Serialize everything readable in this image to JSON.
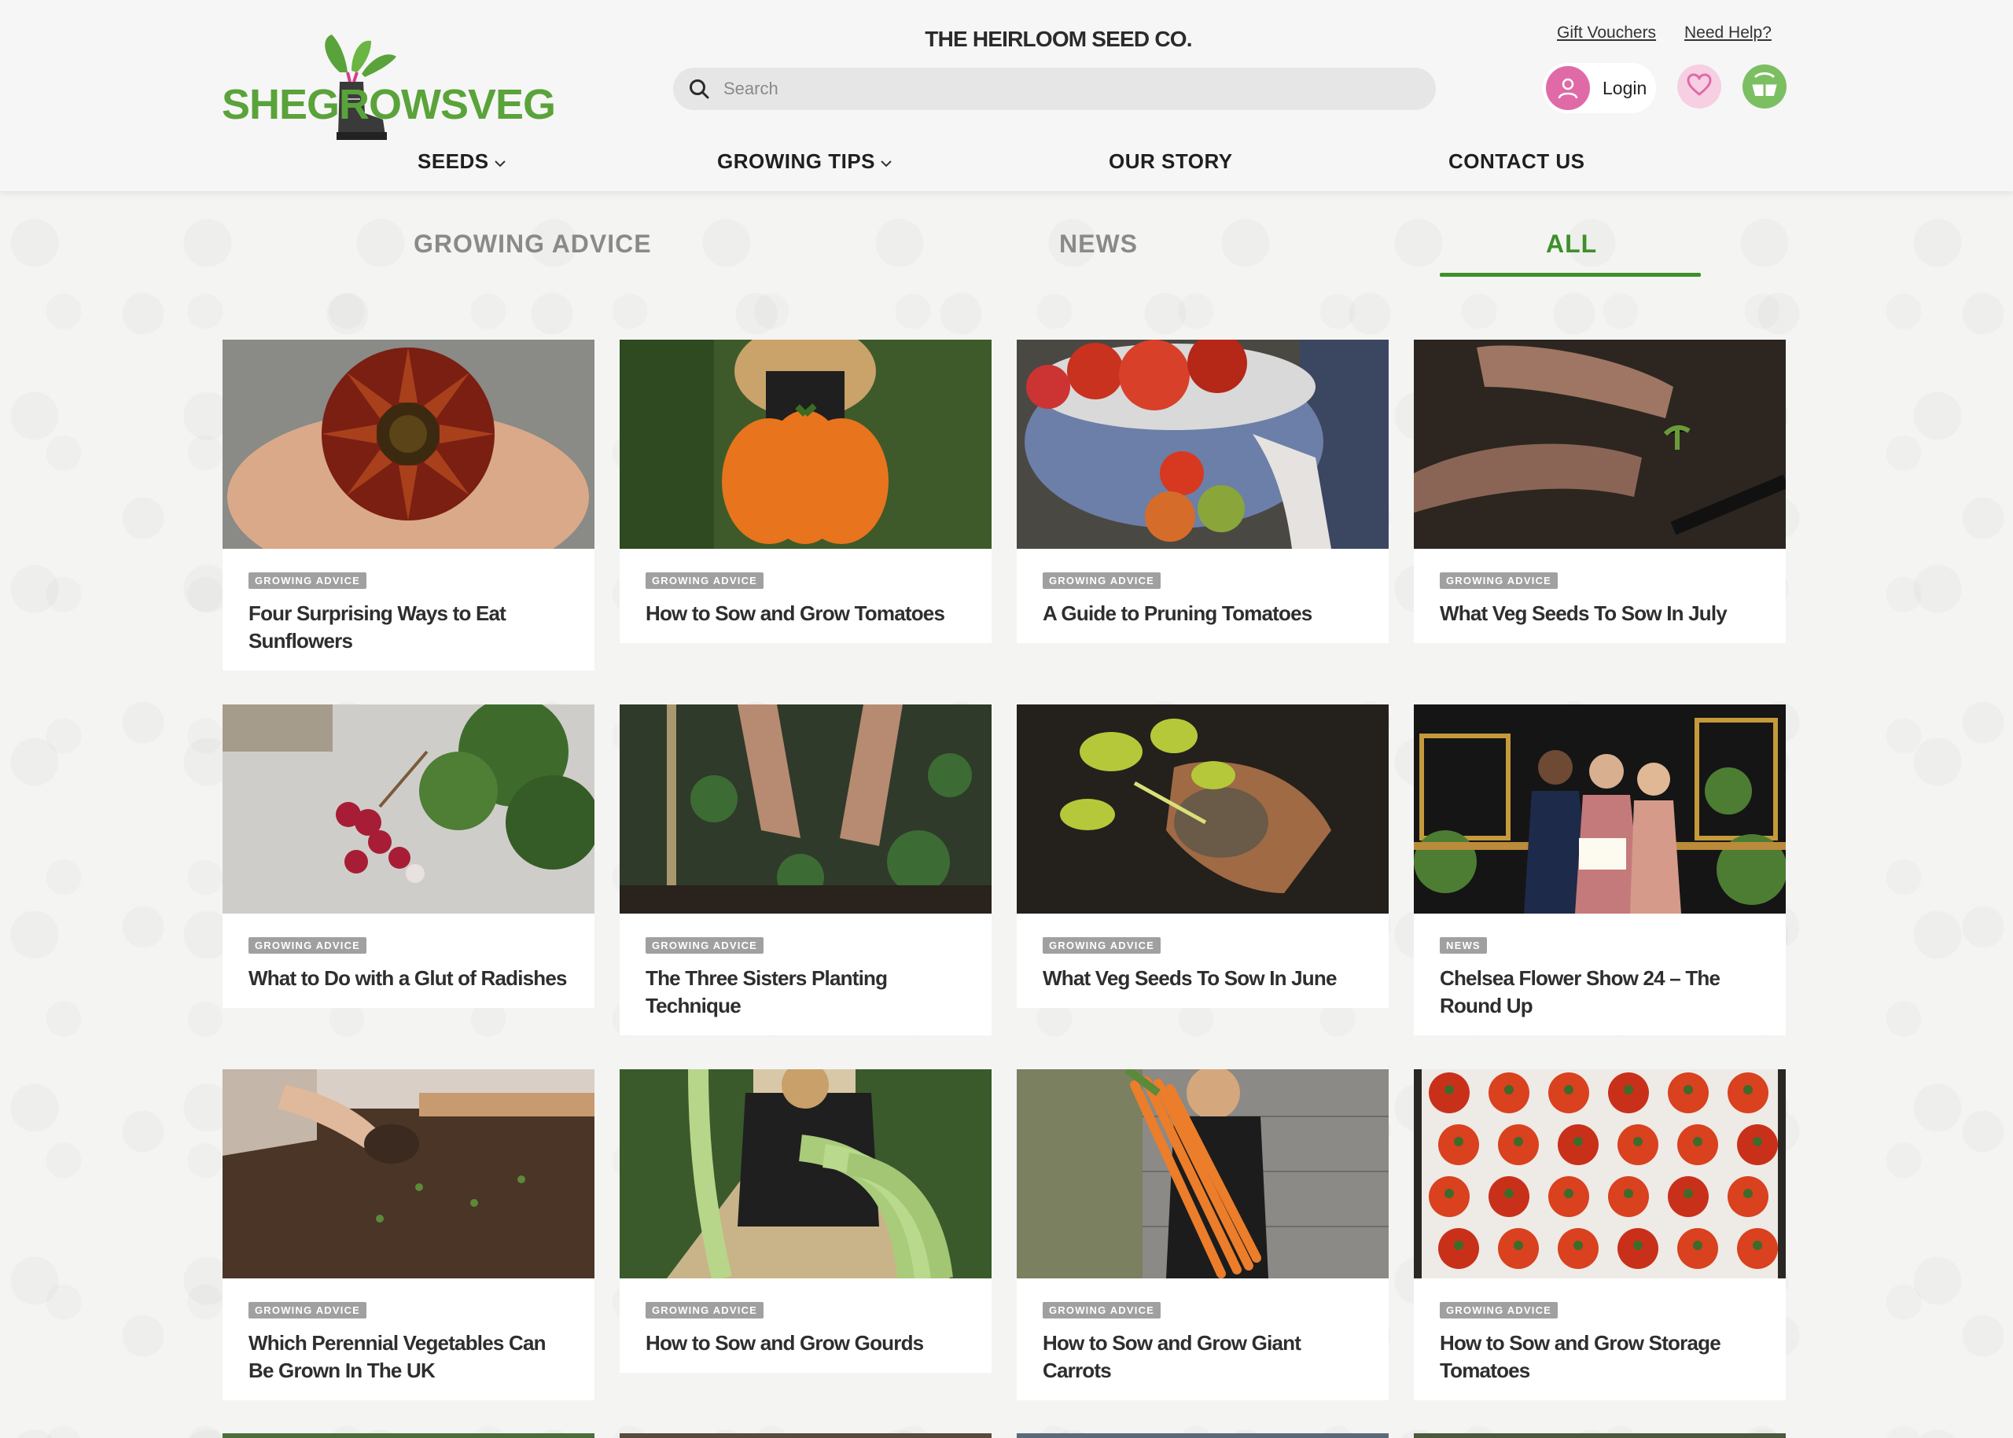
{
  "brand": {
    "logo_text": "SHEGROWSVEG",
    "title": "THE HEIRLOOM SEED CO."
  },
  "search": {
    "placeholder": "Search"
  },
  "top_links": {
    "gift_vouchers": "Gift Vouchers",
    "need_help": "Need Help?"
  },
  "account": {
    "login_label": "Login"
  },
  "nav": {
    "items": [
      {
        "label": "SEEDS",
        "has_dropdown": true
      },
      {
        "label": "GROWING TIPS",
        "has_dropdown": true
      },
      {
        "label": "OUR STORY",
        "has_dropdown": false
      },
      {
        "label": "CONTACT US",
        "has_dropdown": false
      }
    ]
  },
  "filters": {
    "tabs": [
      {
        "label": "GROWING ADVICE",
        "active": false
      },
      {
        "label": "NEWS",
        "active": false
      },
      {
        "label": "ALL",
        "active": true
      }
    ]
  },
  "articles": [
    {
      "category": "GROWING ADVICE",
      "title": "Four Surprising Ways to Eat Sunflowers",
      "image": "sunflower-in-hands"
    },
    {
      "category": "GROWING ADVICE",
      "title": "How to Sow and Grow Tomatoes",
      "image": "orange-heirloom-tomato"
    },
    {
      "category": "GROWING ADVICE",
      "title": "A Guide to Pruning Tomatoes",
      "image": "tomatoes-in-bowl"
    },
    {
      "category": "GROWING ADVICE",
      "title": "What Veg Seeds To Sow In July",
      "image": "hands-planting-seedling"
    },
    {
      "category": "GROWING ADVICE",
      "title": "What to Do with a Glut of Radishes",
      "image": "radish-bunch"
    },
    {
      "category": "GROWING ADVICE",
      "title": "The Three Sisters Planting Technique",
      "image": "hands-in-vegetable-bed"
    },
    {
      "category": "GROWING ADVICE",
      "title": "What Veg Seeds To Sow In June",
      "image": "gloved-hands-seedling"
    },
    {
      "category": "NEWS",
      "title": "Chelsea Flower Show 24 – The Round Up",
      "image": "chelsea-flower-show-group"
    },
    {
      "category": "GROWING ADVICE",
      "title": "Which Perennial Vegetables Can Be Grown In The UK",
      "image": "hands-in-soil"
    },
    {
      "category": "GROWING ADVICE",
      "title": "How to Sow and Grow Gourds",
      "image": "woman-holding-gourds"
    },
    {
      "category": "GROWING ADVICE",
      "title": "How to Sow and Grow Giant Carrots",
      "image": "woman-holding-carrots"
    },
    {
      "category": "GROWING ADVICE",
      "title": "How to Sow and Grow Storage Tomatoes",
      "image": "crate-of-tomatoes"
    }
  ],
  "colors": {
    "accent_green": "#3f8f2a",
    "logo_green": "#5aa33a",
    "login_pink": "#e06aa8",
    "wishlist_pink": "#f6cfe2",
    "badge_grey": "#a0a0a0"
  }
}
